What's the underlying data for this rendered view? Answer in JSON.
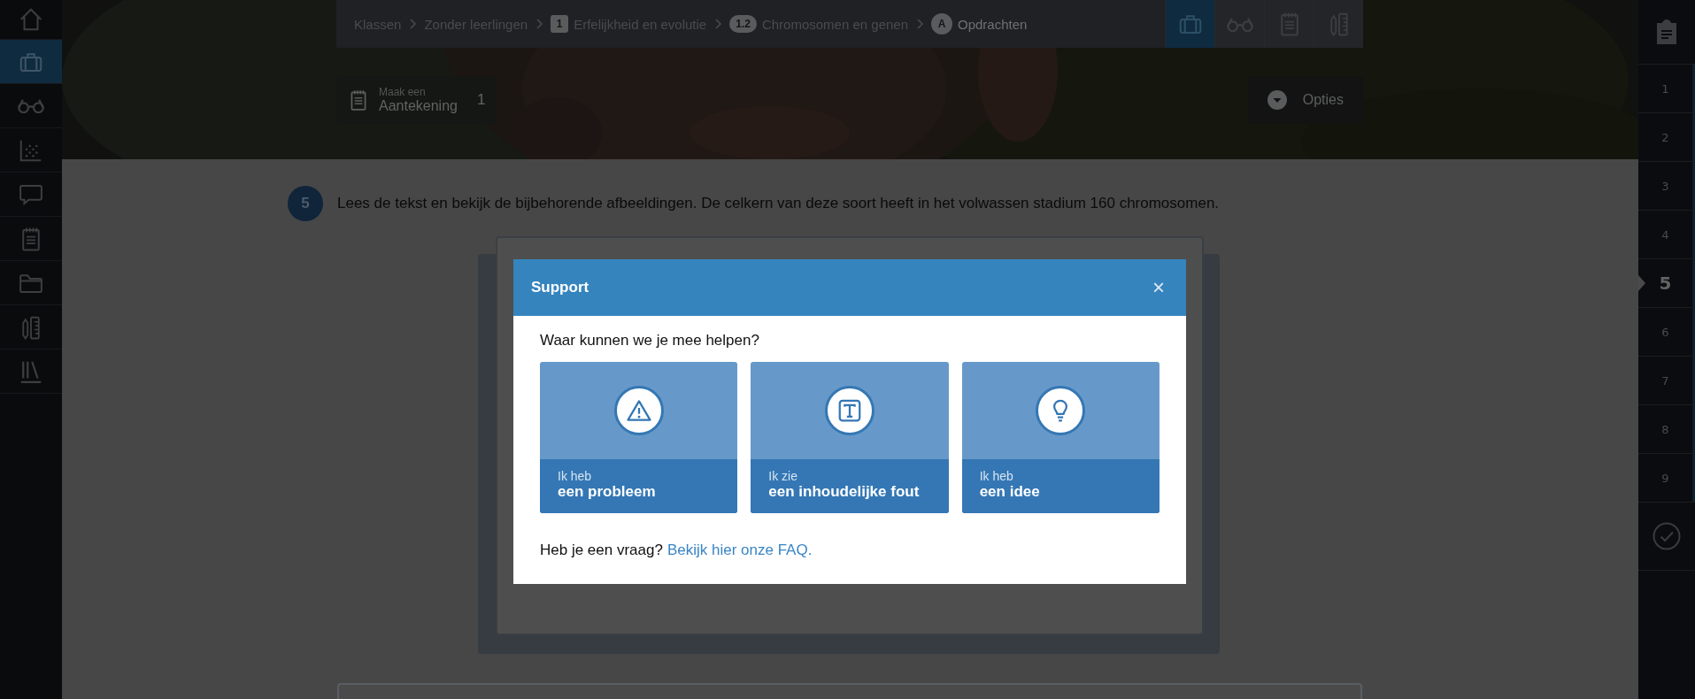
{
  "sidebar": {
    "items": [
      {
        "kind": "home",
        "selected": false
      },
      {
        "kind": "briefcase",
        "selected": true
      },
      {
        "kind": "glasses",
        "selected": false
      },
      {
        "kind": "chart",
        "selected": false
      },
      {
        "kind": "chat",
        "selected": false
      },
      {
        "kind": "notepad",
        "selected": false
      },
      {
        "kind": "folder",
        "selected": false
      },
      {
        "kind": "tools",
        "selected": false
      },
      {
        "kind": "library",
        "selected": false
      }
    ]
  },
  "breadcrumbs": [
    {
      "label": "Klassen"
    },
    {
      "label": "Zonder leerlingen"
    },
    {
      "badge": "1",
      "kind": "square",
      "label": "Erfelijkheid en evolutie"
    },
    {
      "badge": "1.2",
      "kind": "pill",
      "label": "Chromosomen en genen"
    },
    {
      "badge": "A",
      "kind": "circle",
      "label": "Opdrachten",
      "current": true
    }
  ],
  "toolbar": [
    {
      "kind": "briefcase",
      "selected": true
    },
    {
      "kind": "glasses",
      "selected": false
    },
    {
      "kind": "notepad",
      "selected": false
    },
    {
      "kind": "tools",
      "selected": false
    }
  ],
  "note_button": {
    "caption": "Maak een",
    "label": "Aantekening",
    "count": "1"
  },
  "options_button": {
    "label": "Opties"
  },
  "question": {
    "number": "5",
    "text": "Lees de tekst en bekijk de bijbehorende afbeeldingen. De celkern van deze soort heeft in het volwassen stadium 160 chromosomen."
  },
  "modal": {
    "title": "Support",
    "close": "×",
    "prompt": "Waar kunnen we je mee helpen?",
    "options": [
      {
        "kind": "warning",
        "caption": "Ik heb",
        "label": "een probleem"
      },
      {
        "kind": "text",
        "caption": "Ik zie",
        "label": "een inhoudelijke fout"
      },
      {
        "kind": "idea",
        "caption": "Ik heb",
        "label": "een idee"
      }
    ],
    "footer": {
      "text": "Heb je een vraag?",
      "link": "Bekijk hier onze FAQ."
    }
  },
  "question_nav": {
    "items": [
      {
        "label": "1",
        "selected": false
      },
      {
        "label": "2",
        "selected": false
      },
      {
        "label": "3",
        "selected": false
      },
      {
        "label": "4",
        "selected": false
      },
      {
        "label": "5",
        "selected": true
      },
      {
        "label": "6",
        "selected": false
      },
      {
        "label": "7",
        "selected": false
      },
      {
        "label": "8",
        "selected": false
      },
      {
        "label": "9",
        "selected": false
      }
    ]
  }
}
